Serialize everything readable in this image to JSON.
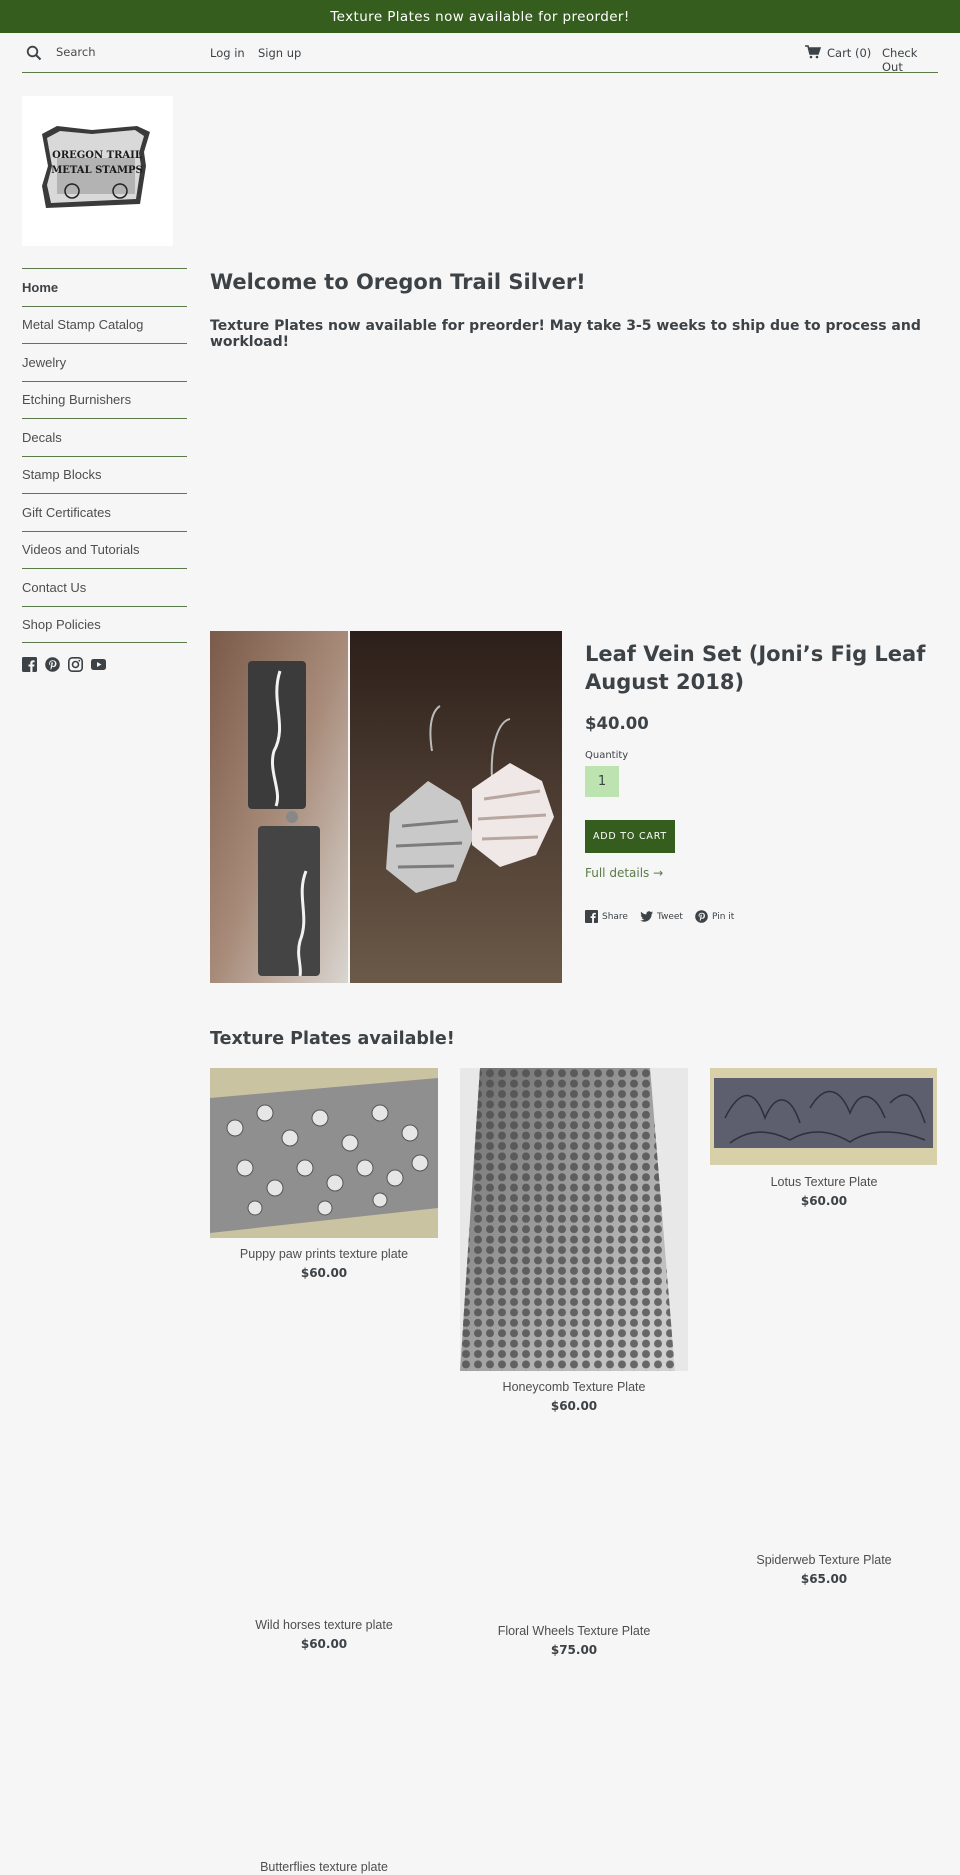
{
  "announcement": "Texture Plates now available for preorder!",
  "header": {
    "search_label": "Search",
    "login": "Log in",
    "signup": "Sign up",
    "cart": "Cart (0)",
    "checkout": "Check Out"
  },
  "logo": {
    "line1": "OREGON TRAIL",
    "line2": "METAL STAMPS"
  },
  "sidebar": {
    "items": [
      {
        "label": "Home"
      },
      {
        "label": "Metal Stamp Catalog"
      },
      {
        "label": "Jewelry"
      },
      {
        "label": "Etching Burnishers"
      },
      {
        "label": "Decals"
      },
      {
        "label": "Stamp Blocks"
      },
      {
        "label": "Gift Certificates"
      },
      {
        "label": "Videos and Tutorials"
      },
      {
        "label": "Contact Us"
      },
      {
        "label": "Shop Policies"
      }
    ],
    "social_icons": [
      "facebook-icon",
      "pinterest-icon",
      "instagram-icon",
      "youtube-icon"
    ]
  },
  "welcome": {
    "title": "Welcome to Oregon Trail Silver!",
    "text": "Texture Plates now available for preorder! May take 3-5 weeks to ship due to process and workload!"
  },
  "featured": {
    "title": "Leaf Vein Set (Joni’s Fig Leaf August 2018)",
    "price": "$40.00",
    "quantity_label": "Quantity",
    "quantity_value": "1",
    "add_to_cart": "ADD TO CART",
    "full_details": "Full details →",
    "share": "Share",
    "tweet": "Tweet",
    "pin": "Pin it"
  },
  "collection": {
    "title": "Texture Plates available!",
    "products": [
      {
        "name": "Puppy paw prints texture plate",
        "price": "$60.00"
      },
      {
        "name": "Honeycomb Texture Plate",
        "price": "$60.00"
      },
      {
        "name": "Lotus Texture Plate",
        "price": "$60.00"
      },
      {
        "name": "Wild horses texture plate",
        "price": "$60.00"
      },
      {
        "name": "Floral Wheels Texture Plate",
        "price": "$75.00"
      },
      {
        "name": "Spiderweb Texture Plate",
        "price": "$65.00"
      },
      {
        "name": "Butterflies texture plate",
        "price": ""
      }
    ]
  },
  "colors": {
    "brand_green": "#345d1e",
    "qty_bg": "#bde3b0",
    "background": "#f6f6f6"
  }
}
